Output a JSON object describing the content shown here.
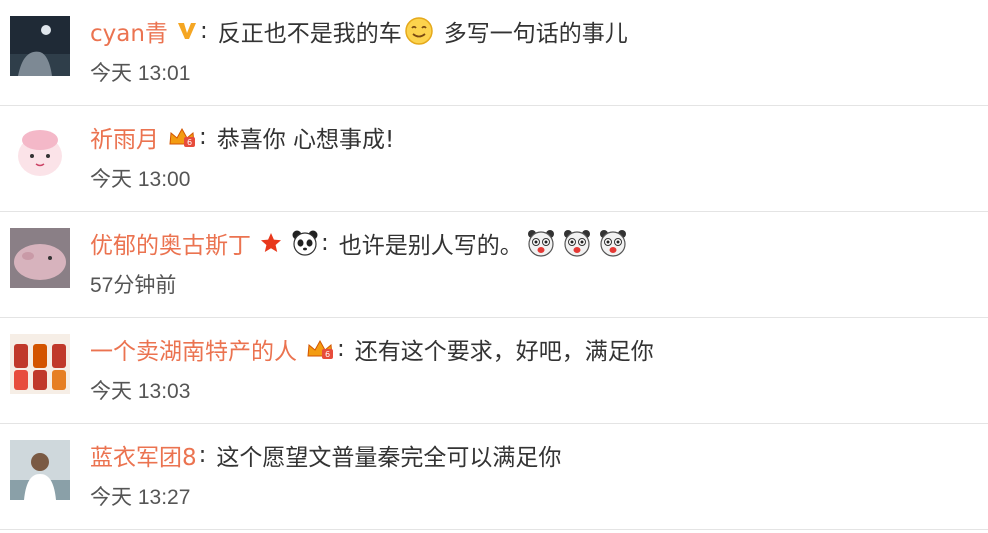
{
  "comments": [
    {
      "username": "cyan青",
      "badge": "verified-v-icon",
      "text": "反正也不是我的车",
      "emoji": "smiling-face-emoji-icon",
      "text2": "多写一句话的事儿",
      "time": "今天 13:01"
    },
    {
      "username": "祈雨月",
      "badge": "crown-member-icon",
      "text": "恭喜你 心想事成!",
      "time": "今天 13:00"
    },
    {
      "username": "优郁的奥古斯丁",
      "badge": "star-icon",
      "badge2": "panda-icon",
      "text": "也许是别人写的。",
      "emoji": "surprised-face-emoji-icon",
      "time": "57分钟前"
    },
    {
      "username": "一个卖湖南特产的人",
      "badge": "crown-member-icon",
      "text": "还有这个要求，好吧，满足你",
      "time": "今天 13:03"
    },
    {
      "username": "蓝衣军团8",
      "text": "这个愿望文普量秦完全可以满足你",
      "time": "今天 13:27"
    }
  ],
  "colors": {
    "username": "#eb7350",
    "text": "#333333",
    "time": "#555555",
    "divider": "#e4e4e4"
  }
}
